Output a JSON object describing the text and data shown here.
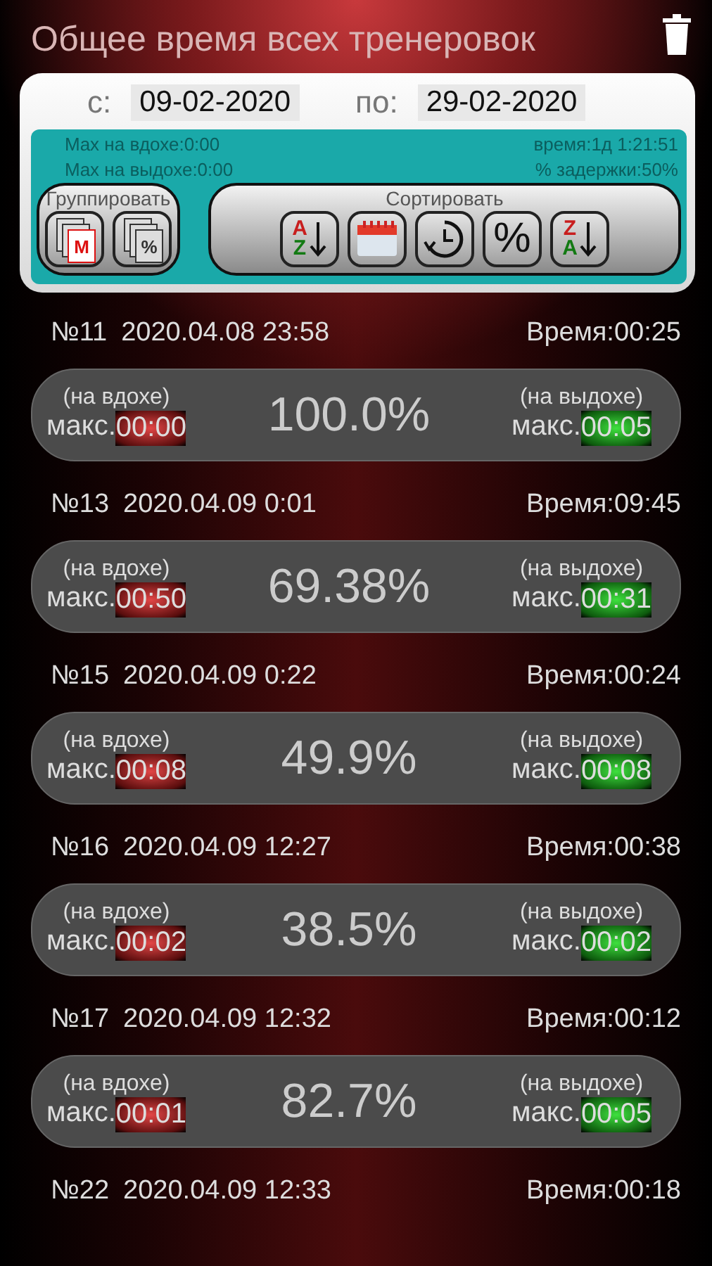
{
  "title": "Общее время всех тренеровок",
  "date_from": {
    "label": "с:",
    "value": "09-02-2020"
  },
  "date_to": {
    "label": "по:",
    "value": "29-02-2020"
  },
  "stats": {
    "max_inhale": "Max на вдохе:0:00",
    "total_time": "время:1д 1:21:51",
    "max_exhale": "Max на выдохе:0:00",
    "hold_percent": "% задержки:50%"
  },
  "group": {
    "label": "Группировать",
    "buttons": [
      {
        "kind": "doc",
        "mark": "M"
      },
      {
        "kind": "doc",
        "mark": "%"
      }
    ]
  },
  "sort": {
    "label": "Сортировать",
    "buttons": [
      {
        "kind": "alpha",
        "top": "A",
        "bottom": "Z"
      },
      {
        "kind": "calendar"
      },
      {
        "kind": "clock"
      },
      {
        "kind": "glyph",
        "glyph": "%"
      },
      {
        "kind": "alpha",
        "top": "Z",
        "bottom": "A"
      }
    ]
  },
  "sessions": [
    {
      "number": "№11",
      "datetime": "2020.04.08 23:58",
      "duration": "Время:00:25",
      "inhale_label": "(на вдохе)",
      "inhale_prefix": "макс.",
      "inhale_value": "00:00",
      "percent": "100.0%",
      "exhale_label": "(на выдохе)",
      "exhale_prefix": "макс.",
      "exhale_value": "00:05"
    },
    {
      "number": "№13",
      "datetime": "2020.04.09 0:01",
      "duration": "Время:09:45",
      "inhale_label": "(на вдохе)",
      "inhale_prefix": "макс.",
      "inhale_value": "00:50",
      "percent": "69.38%",
      "exhale_label": "(на выдохе)",
      "exhale_prefix": "макс.",
      "exhale_value": "00:31"
    },
    {
      "number": "№15",
      "datetime": "2020.04.09 0:22",
      "duration": "Время:00:24",
      "inhale_label": "(на вдохе)",
      "inhale_prefix": "макс.",
      "inhale_value": "00:08",
      "percent": "49.9%",
      "exhale_label": "(на выдохе)",
      "exhale_prefix": "макс.",
      "exhale_value": "00:08"
    },
    {
      "number": "№16",
      "datetime": "2020.04.09 12:27",
      "duration": "Время:00:38",
      "inhale_label": "(на вдохе)",
      "inhale_prefix": "макс.",
      "inhale_value": "00:02",
      "percent": "38.5%",
      "exhale_label": "(на выдохе)",
      "exhale_prefix": "макс.",
      "exhale_value": "00:02"
    },
    {
      "number": "№17",
      "datetime": "2020.04.09 12:32",
      "duration": "Время:00:12",
      "inhale_label": "(на вдохе)",
      "inhale_prefix": "макс.",
      "inhale_value": "00:01",
      "percent": "82.7%",
      "exhale_label": "(на выдохе)",
      "exhale_prefix": "макс.",
      "exhale_value": "00:05"
    },
    {
      "number": "№22",
      "datetime": "2020.04.09 12:33",
      "duration": "Время:00:18"
    }
  ]
}
